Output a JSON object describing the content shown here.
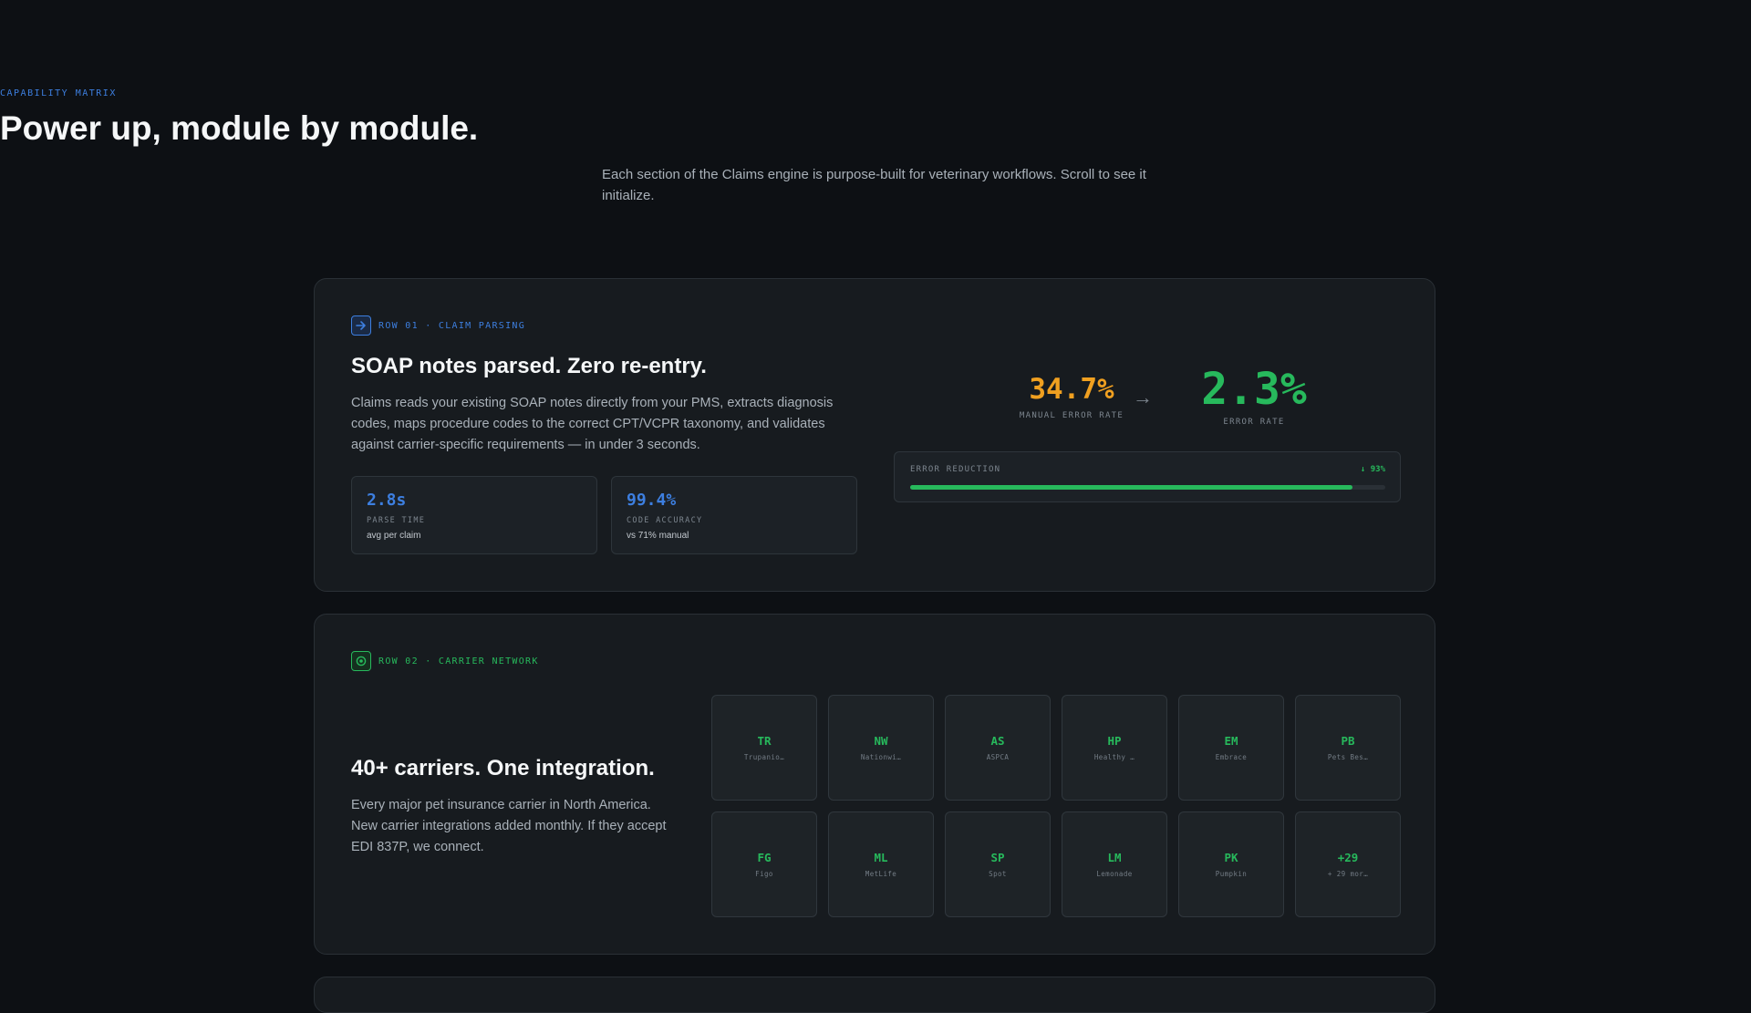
{
  "header": {
    "eyebrow": "CAPABILITY MATRIX",
    "title": "Power up, module by module.",
    "subtitle": "Each section of the Claims engine is purpose-built for veterinary workflows. Scroll to see it initialize."
  },
  "row1": {
    "tag": "ROW 01 · CLAIM PARSING",
    "icon": "arrow-right-icon",
    "heading": "SOAP notes parsed. Zero re-entry.",
    "description": "Claims reads your existing SOAP notes directly from your PMS, extracts diagnosis codes, maps procedure codes to the correct CPT/VCPR taxonomy, and validates against carrier-specific requirements — in under 3 seconds.",
    "stats": [
      {
        "value": "2.8s",
        "label": "PARSE TIME",
        "note": "avg per claim"
      },
      {
        "value": "99.4%",
        "label": "CODE ACCURACY",
        "note": "vs 71% manual"
      }
    ],
    "before": {
      "value": "34.7%",
      "label": "MANUAL ERROR RATE"
    },
    "arrow": "→",
    "after": {
      "value": "2.3%",
      "label": "ERROR RATE"
    },
    "reduction": {
      "label": "ERROR REDUCTION",
      "value_text": "↓ 93%",
      "fill_percent": 93
    }
  },
  "row2": {
    "tag": "ROW 02 · CARRIER NETWORK",
    "icon": "target-icon",
    "heading": "40+ carriers. One integration.",
    "description": "Every major pet insurance carrier in North America. New carrier integrations added monthly. If they accept EDI 837P, we connect.",
    "carriers": [
      {
        "abbr": "TR",
        "name": "Trupanio…"
      },
      {
        "abbr": "NW",
        "name": "Nationwi…"
      },
      {
        "abbr": "AS",
        "name": "ASPCA"
      },
      {
        "abbr": "HP",
        "name": "Healthy …"
      },
      {
        "abbr": "EM",
        "name": "Embrace"
      },
      {
        "abbr": "PB",
        "name": "Pets Bes…"
      },
      {
        "abbr": "FG",
        "name": "Figo"
      },
      {
        "abbr": "ML",
        "name": "MetLife"
      },
      {
        "abbr": "SP",
        "name": "Spot"
      },
      {
        "abbr": "LM",
        "name": "Lemonade"
      },
      {
        "abbr": "PK",
        "name": "Pumpkin"
      },
      {
        "abbr": "+29",
        "name": "+ 29 mor…"
      }
    ]
  },
  "colors": {
    "accent_blue": "#3d7fe0",
    "accent_green": "#27b95c",
    "accent_orange": "#f0a020"
  }
}
